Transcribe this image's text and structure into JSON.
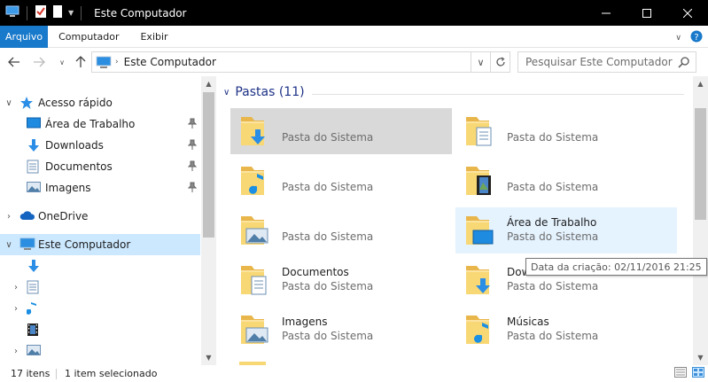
{
  "window": {
    "title": "Este Computador"
  },
  "ribbon": {
    "tabs": [
      "Arquivo",
      "Computador",
      "Exibir"
    ]
  },
  "address": {
    "path": "Este Computador"
  },
  "search": {
    "placeholder": "Pesquisar Este Computador"
  },
  "sidebar": {
    "quick_access": "Acesso rápido",
    "quick_items": [
      "Área de Trabalho",
      "Downloads",
      "Documentos",
      "Imagens"
    ],
    "onedrive": "OneDrive",
    "this_pc": "Este Computador"
  },
  "content": {
    "group_title": "Pastas (11)",
    "tiles": [
      {
        "name": "",
        "sub": "Pasta do Sistema",
        "icon": "downloads-folder-icon"
      },
      {
        "name": "",
        "sub": "Pasta do Sistema",
        "icon": "documents-folder-icon"
      },
      {
        "name": "",
        "sub": "Pasta do Sistema",
        "icon": "music-folder-icon"
      },
      {
        "name": "",
        "sub": "Pasta do Sistema",
        "icon": "videos-folder-icon"
      },
      {
        "name": "",
        "sub": "Pasta do Sistema",
        "icon": "pictures-folder-icon"
      },
      {
        "name": "Área de Trabalho",
        "sub": "Pasta do Sistema",
        "icon": "desktop-folder-icon"
      },
      {
        "name": "Documentos",
        "sub": "Pasta do Sistema",
        "icon": "documents-folder-icon"
      },
      {
        "name": "Downloads",
        "sub": "Pasta do Sistema",
        "icon": "downloads-folder-icon"
      },
      {
        "name": "Imagens",
        "sub": "Pasta do Sistema",
        "icon": "pictures-folder-icon"
      },
      {
        "name": "Músicas",
        "sub": "Pasta do Sistema",
        "icon": "music-folder-icon"
      }
    ]
  },
  "tooltip": {
    "text": "Data da criação: 02/11/2016 21:25"
  },
  "status": {
    "count": "17 itens",
    "selected": "1 item selecionado"
  },
  "colors": {
    "accent": "#1979ca",
    "selection": "#cce8ff",
    "folder": "#f8d775",
    "header": "#1e3287"
  }
}
